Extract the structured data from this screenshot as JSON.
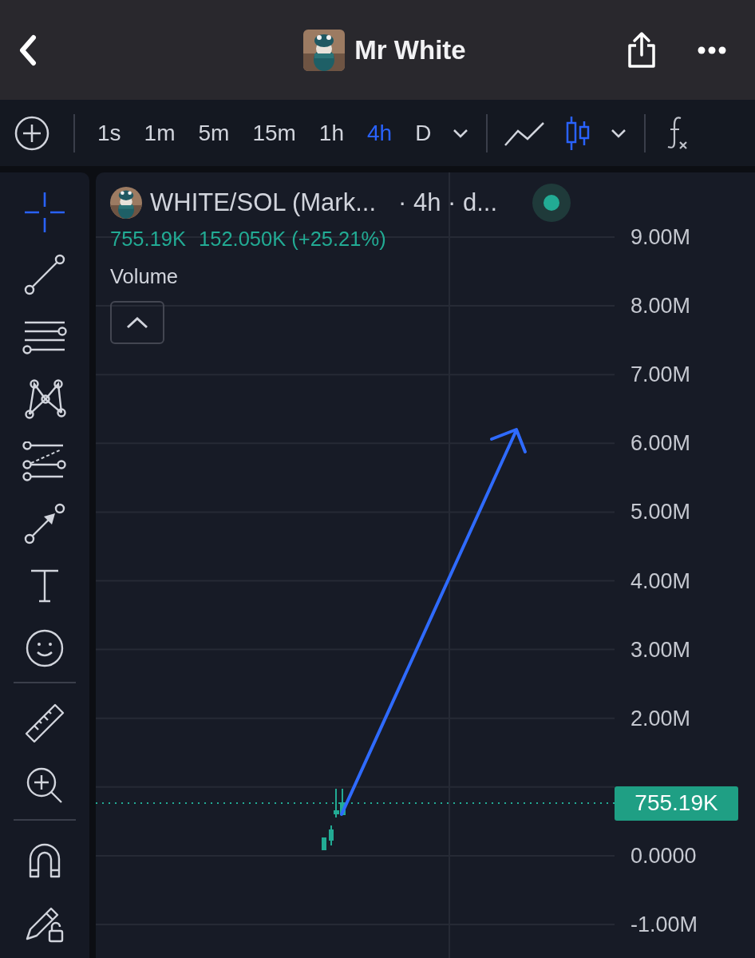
{
  "header": {
    "title": "Mr White"
  },
  "toolbar": {
    "intervals": [
      {
        "label": "1s",
        "selected": false
      },
      {
        "label": "1m",
        "selected": false
      },
      {
        "label": "5m",
        "selected": false
      },
      {
        "label": "15m",
        "selected": false
      },
      {
        "label": "1h",
        "selected": false
      },
      {
        "label": "4h",
        "selected": true
      },
      {
        "label": "D",
        "selected": false
      }
    ],
    "chart_styles": [
      {
        "kind": "line",
        "selected": false
      },
      {
        "kind": "candles",
        "selected": true
      }
    ]
  },
  "drawing_tools": [
    {
      "tools": [
        {
          "kind": "crosshair",
          "selected": true
        },
        {
          "kind": "trend-line",
          "selected": false
        },
        {
          "kind": "parallel-lines",
          "selected": false
        },
        {
          "kind": "pattern",
          "selected": false
        },
        {
          "kind": "fib",
          "selected": false
        },
        {
          "kind": "arrow",
          "selected": false
        },
        {
          "kind": "text",
          "selected": false
        },
        {
          "kind": "emoji",
          "selected": false
        }
      ]
    },
    {
      "tools": [
        {
          "kind": "ruler",
          "selected": false
        },
        {
          "kind": "zoom",
          "selected": false
        }
      ]
    },
    {
      "tools": [
        {
          "kind": "magnet",
          "selected": false
        },
        {
          "kind": "lock-pencil",
          "selected": false
        }
      ]
    }
  ],
  "chart": {
    "symbol": "WHITE/SOL (Mark...",
    "interval": "· 4h · d...",
    "live": true,
    "last_price": "755.19K",
    "change": "152.050K (+25.21%)",
    "study": "Volume",
    "price_labels_upper": [
      "9.00M",
      "8.00M",
      "7.00M",
      "6.00M",
      "5.00M",
      "4.00M",
      "3.00M",
      "2.00M"
    ],
    "price_labels_lower": [
      "0.0000",
      "-1.00M"
    ],
    "current_price": "755.19K"
  }
}
